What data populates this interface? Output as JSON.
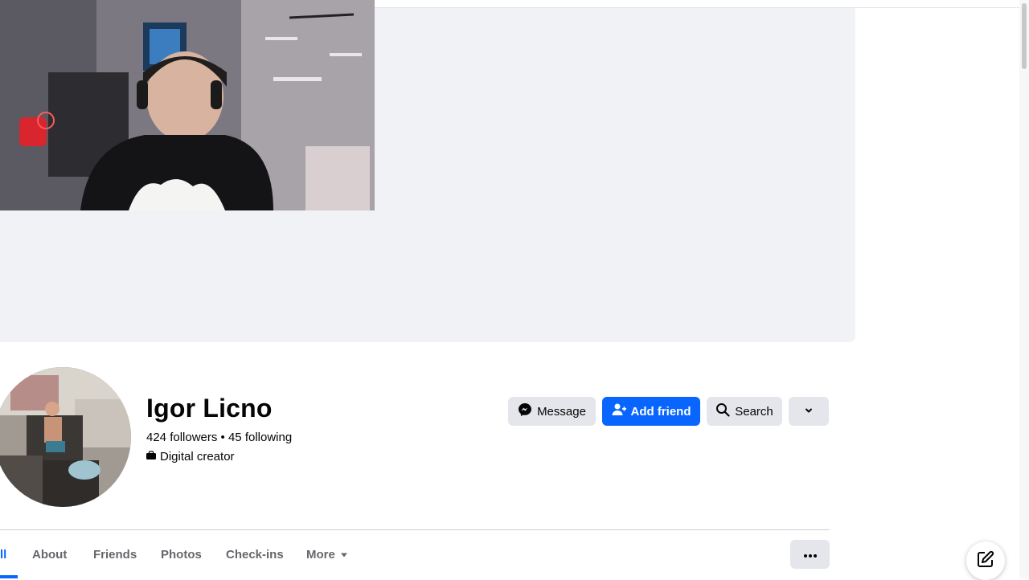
{
  "profile": {
    "name": "Igor Licno",
    "stats": "424 followers • 45 following",
    "category": "Digital creator"
  },
  "actions": {
    "message": "Message",
    "add_friend": "Add friend",
    "search": "Search"
  },
  "tabs": {
    "active_fragment": "ll",
    "about": "About",
    "friends": "Friends",
    "photos": "Photos",
    "checkins": "Check-ins",
    "more": "More"
  },
  "colors": {
    "accent": "#0866ff",
    "button_grey": "#e4e6eb",
    "cover_bg": "#f0f2f5"
  },
  "icons": [
    "messenger-icon",
    "add-friend-icon",
    "search-icon",
    "chevron-down-icon",
    "briefcase-icon",
    "caret-down-icon",
    "ellipsis-icon",
    "compose-icon"
  ]
}
